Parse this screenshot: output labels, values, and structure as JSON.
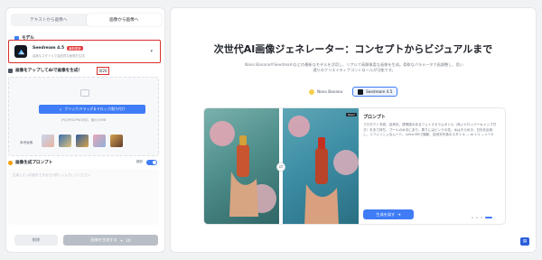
{
  "left": {
    "tabs": [
      {
        "label": "テキストから画像へ"
      },
      {
        "label": "画像から画像へ"
      }
    ],
    "model_section": {
      "label": "モデル",
      "name": "Seedream 4.5",
      "badge": "最新更新",
      "desc": "高度なスタイルで高品質な画像を生成"
    },
    "upload_section": {
      "label": "画像をアップしてAIで画像を生成！",
      "count": "0/20",
      "button": "クリック/ドラッグ＆ドロップ/貼り付け",
      "hint": "JPG/JPEG/PNG対応、最大10MB",
      "ref_label": "参考画像"
    },
    "prompt_section": {
      "label": "画像生成プロンプト",
      "translate": "翻訳",
      "placeholder": "生成したい内容をできるだけ詳しく入力してください"
    },
    "buttons": {
      "clear": "削除",
      "generate": "画像を生成する",
      "credits": "20"
    }
  },
  "right": {
    "title": "次世代AI画像ジェネレーター：コンセプトからビジュアルまで",
    "subtitle": "Nano BananaやSeedreamなどの最新なモデルを活用し、リアルで高解像度な画像を生成。柔軟なパラメータで画調整し、思い通りのクリエイティブコントロールが可能です。",
    "model_tabs": [
      {
        "label": "Nano Banana"
      },
      {
        "label": "Seedream 4.5"
      }
    ],
    "card": {
      "tag": "Seed",
      "prompt_title": "プロンプト",
      "prompt_text": "プロダクト写真、自然光、透明感のあるフェイスセラムボトル（赤いドロッパーキャップ付き）を手で持ち、プールの水中にあり、周りにはピンクの花。水はきらめき、日光を反射し、リフレッシュなムード。Leica M6で撮影、自然光写真のスタイル — ar 1:1 — v 7.0",
      "try_label": "生成を試す"
    }
  },
  "colors": {
    "accent": "#3f7cf6",
    "highlight_box": "#d9302a"
  }
}
